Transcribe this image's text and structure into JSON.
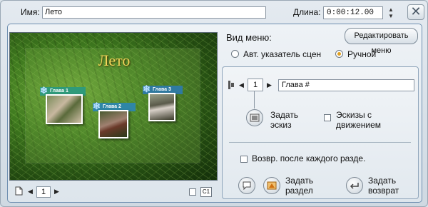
{
  "header": {
    "name_label": "Имя:",
    "name_value": "Лето",
    "duration_label": "Длина:",
    "duration_value": "0:00:12.00",
    "spin_up": "▲",
    "spin_down": "▼",
    "close_glyph": "✕"
  },
  "preview": {
    "menu_title": "Лето",
    "chapters": [
      "Глава 1",
      "Глава 2",
      "Глава 3"
    ],
    "page_number": "1",
    "c1_label": "C1"
  },
  "menu_type": {
    "label": "Вид меню:",
    "edit_button": "Редактировать меню",
    "auto_option": "Авт. указатель сцен",
    "manual_option": "Ручной",
    "selected": "manual"
  },
  "chapter_editor": {
    "number": "1",
    "name": "Глава #",
    "set_thumbnail": "Задать эскиз",
    "motion_thumbnails": "Эскизы с движением",
    "return_after_each": "Возвр. после каждого разде.",
    "set_chapter": "Задать раздел",
    "set_return": "Задать возврат"
  },
  "colors": {
    "frame_border": "#6f8fb0",
    "title_gold": "#f2d65a",
    "radio_selected": "#e0a020"
  }
}
